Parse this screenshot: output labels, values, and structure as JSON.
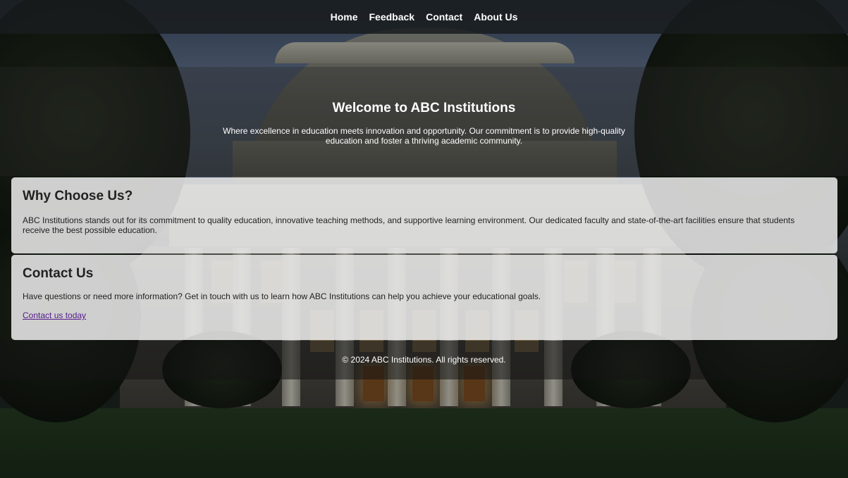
{
  "nav": {
    "items": [
      "Home",
      "Feedback",
      "Contact",
      "About Us"
    ]
  },
  "hero": {
    "title": "Welcome to ABC Institutions",
    "text": "Where excellence in education meets innovation and opportunity. Our commitment is to provide high-quality education and foster a thriving academic community."
  },
  "why": {
    "heading": "Why Choose Us?",
    "text": "ABC Institutions stands out for its commitment to quality education, innovative teaching methods, and supportive learning environment. Our dedicated faculty and state-of-the-art facilities ensure that students receive the best possible education."
  },
  "contact": {
    "heading": "Contact Us",
    "text": "Have questions or need more information? Get in touch with us to learn how ABC Institutions can help you achieve your educational goals.",
    "link_label": "Contact us today"
  },
  "footer": {
    "text": "© 2024 ABC Institutions. All rights reserved."
  },
  "colors": {
    "link": "#551a8b",
    "text_light": "#ffffff",
    "text_dark": "#222222"
  }
}
